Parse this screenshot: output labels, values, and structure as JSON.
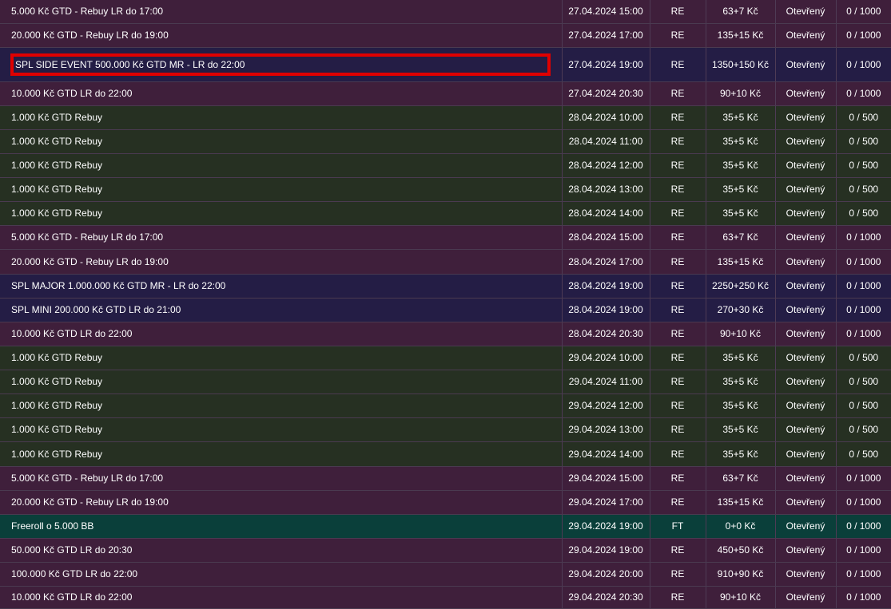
{
  "rows": [
    {
      "name": "5.000 Kč GTD - Rebuy LR do 17:00",
      "datetime": "27.04.2024 15:00",
      "game": "RE",
      "buyin": "63+7 Kč",
      "status": "Otevřený",
      "players": "0 / 1000",
      "type": "purple"
    },
    {
      "name": "20.000 Kč GTD - Rebuy LR do 19:00",
      "datetime": "27.04.2024 17:00",
      "game": "RE",
      "buyin": "135+15 Kč",
      "status": "Otevřený",
      "players": "0 / 1000",
      "type": "purple"
    },
    {
      "name": "SPL SIDE EVENT 500.000 Kč GTD MR - LR do 22:00",
      "datetime": "27.04.2024 19:00",
      "game": "RE",
      "buyin": "1350+150 Kč",
      "status": "Otevřený",
      "players": "0 / 1000",
      "type": "navy",
      "highlighted": true
    },
    {
      "name": "10.000 Kč GTD LR do 22:00",
      "datetime": "27.04.2024 20:30",
      "game": "RE",
      "buyin": "90+10 Kč",
      "status": "Otevřený",
      "players": "0 / 1000",
      "type": "purple"
    },
    {
      "name": "1.000 Kč GTD Rebuy",
      "datetime": "28.04.2024 10:00",
      "game": "RE",
      "buyin": "35+5 Kč",
      "status": "Otevřený",
      "players": "0 / 500",
      "type": "green"
    },
    {
      "name": "1.000 Kč GTD Rebuy",
      "datetime": "28.04.2024 11:00",
      "game": "RE",
      "buyin": "35+5 Kč",
      "status": "Otevřený",
      "players": "0 / 500",
      "type": "green"
    },
    {
      "name": "1.000 Kč GTD Rebuy",
      "datetime": "28.04.2024 12:00",
      "game": "RE",
      "buyin": "35+5 Kč",
      "status": "Otevřený",
      "players": "0 / 500",
      "type": "green"
    },
    {
      "name": "1.000 Kč GTD Rebuy",
      "datetime": "28.04.2024 13:00",
      "game": "RE",
      "buyin": "35+5 Kč",
      "status": "Otevřený",
      "players": "0 / 500",
      "type": "green"
    },
    {
      "name": "1.000 Kč GTD Rebuy",
      "datetime": "28.04.2024 14:00",
      "game": "RE",
      "buyin": "35+5 Kč",
      "status": "Otevřený",
      "players": "0 / 500",
      "type": "green"
    },
    {
      "name": "5.000 Kč GTD - Rebuy LR do 17:00",
      "datetime": "28.04.2024 15:00",
      "game": "RE",
      "buyin": "63+7 Kč",
      "status": "Otevřený",
      "players": "0 / 1000",
      "type": "purple"
    },
    {
      "name": "20.000 Kč GTD - Rebuy LR do 19:00",
      "datetime": "28.04.2024 17:00",
      "game": "RE",
      "buyin": "135+15 Kč",
      "status": "Otevřený",
      "players": "0 / 1000",
      "type": "purple"
    },
    {
      "name": "SPL MAJOR 1.000.000 Kč GTD MR - LR do 22:00",
      "datetime": "28.04.2024 19:00",
      "game": "RE",
      "buyin": "2250+250 Kč",
      "status": "Otevřený",
      "players": "0 / 1000",
      "type": "navy"
    },
    {
      "name": "SPL MINI 200.000 Kč GTD LR do 21:00",
      "datetime": "28.04.2024 19:00",
      "game": "RE",
      "buyin": "270+30 Kč",
      "status": "Otevřený",
      "players": "0 / 1000",
      "type": "navy"
    },
    {
      "name": "10.000 Kč GTD LR do 22:00",
      "datetime": "28.04.2024 20:30",
      "game": "RE",
      "buyin": "90+10 Kč",
      "status": "Otevřený",
      "players": "0 / 1000",
      "type": "purple"
    },
    {
      "name": "1.000 Kč GTD Rebuy",
      "datetime": "29.04.2024 10:00",
      "game": "RE",
      "buyin": "35+5 Kč",
      "status": "Otevřený",
      "players": "0 / 500",
      "type": "green"
    },
    {
      "name": "1.000 Kč GTD Rebuy",
      "datetime": "29.04.2024 11:00",
      "game": "RE",
      "buyin": "35+5 Kč",
      "status": "Otevřený",
      "players": "0 / 500",
      "type": "green"
    },
    {
      "name": "1.000 Kč GTD Rebuy",
      "datetime": "29.04.2024 12:00",
      "game": "RE",
      "buyin": "35+5 Kč",
      "status": "Otevřený",
      "players": "0 / 500",
      "type": "green"
    },
    {
      "name": "1.000 Kč GTD Rebuy",
      "datetime": "29.04.2024 13:00",
      "game": "RE",
      "buyin": "35+5 Kč",
      "status": "Otevřený",
      "players": "0 / 500",
      "type": "green"
    },
    {
      "name": "1.000 Kč GTD Rebuy",
      "datetime": "29.04.2024 14:00",
      "game": "RE",
      "buyin": "35+5 Kč",
      "status": "Otevřený",
      "players": "0 / 500",
      "type": "green"
    },
    {
      "name": "5.000 Kč GTD - Rebuy LR do 17:00",
      "datetime": "29.04.2024 15:00",
      "game": "RE",
      "buyin": "63+7 Kč",
      "status": "Otevřený",
      "players": "0 / 1000",
      "type": "purple"
    },
    {
      "name": "20.000 Kč GTD - Rebuy LR do 19:00",
      "datetime": "29.04.2024 17:00",
      "game": "RE",
      "buyin": "135+15 Kč",
      "status": "Otevřený",
      "players": "0 / 1000",
      "type": "purple"
    },
    {
      "name": "Freeroll o 5.000 BB",
      "datetime": "29.04.2024 19:00",
      "game": "FT",
      "buyin": "0+0 Kč",
      "status": "Otevřený",
      "players": "0 / 1000",
      "type": "teal"
    },
    {
      "name": "50.000 Kč GTD LR do 20:30",
      "datetime": "29.04.2024 19:00",
      "game": "RE",
      "buyin": "450+50 Kč",
      "status": "Otevřený",
      "players": "0 / 1000",
      "type": "purple"
    },
    {
      "name": "100.000 Kč GTD LR do 22:00",
      "datetime": "29.04.2024 20:00",
      "game": "RE",
      "buyin": "910+90 Kč",
      "status": "Otevřený",
      "players": "0 / 1000",
      "type": "purple"
    },
    {
      "name": "10.000 Kč GTD LR do 22:00",
      "datetime": "29.04.2024 20:30",
      "game": "RE",
      "buyin": "90+10 Kč",
      "status": "Otevřený",
      "players": "0 / 1000",
      "type": "purple"
    }
  ]
}
